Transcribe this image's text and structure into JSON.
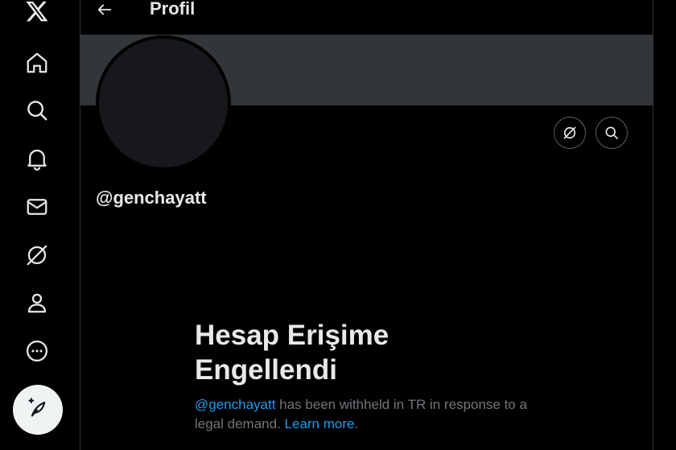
{
  "sidebar": {
    "items": [
      {
        "name": "x-logo-icon"
      },
      {
        "name": "home-icon"
      },
      {
        "name": "search-icon"
      },
      {
        "name": "notifications-icon"
      },
      {
        "name": "messages-icon"
      },
      {
        "name": "grok-icon"
      },
      {
        "name": "profile-icon"
      },
      {
        "name": "more-icon"
      }
    ],
    "compose": {
      "name": "compose-post-icon"
    }
  },
  "header": {
    "title": "Profil"
  },
  "profile": {
    "handle": "@genchayatt"
  },
  "withheld": {
    "title_line1": "Hesap Erişime",
    "title_line2": "Engellendi",
    "handle_link": "@genchayatt",
    "message": " has been withheld in TR in response to a legal demand. ",
    "learn_more": "Learn more",
    "period": "."
  },
  "colors": {
    "background": "#000000",
    "banner": "#333639",
    "text": "#e7e9ea",
    "secondary_text": "#71767b",
    "link": "#1d9bf0",
    "compose_bg": "#eff3f4"
  }
}
